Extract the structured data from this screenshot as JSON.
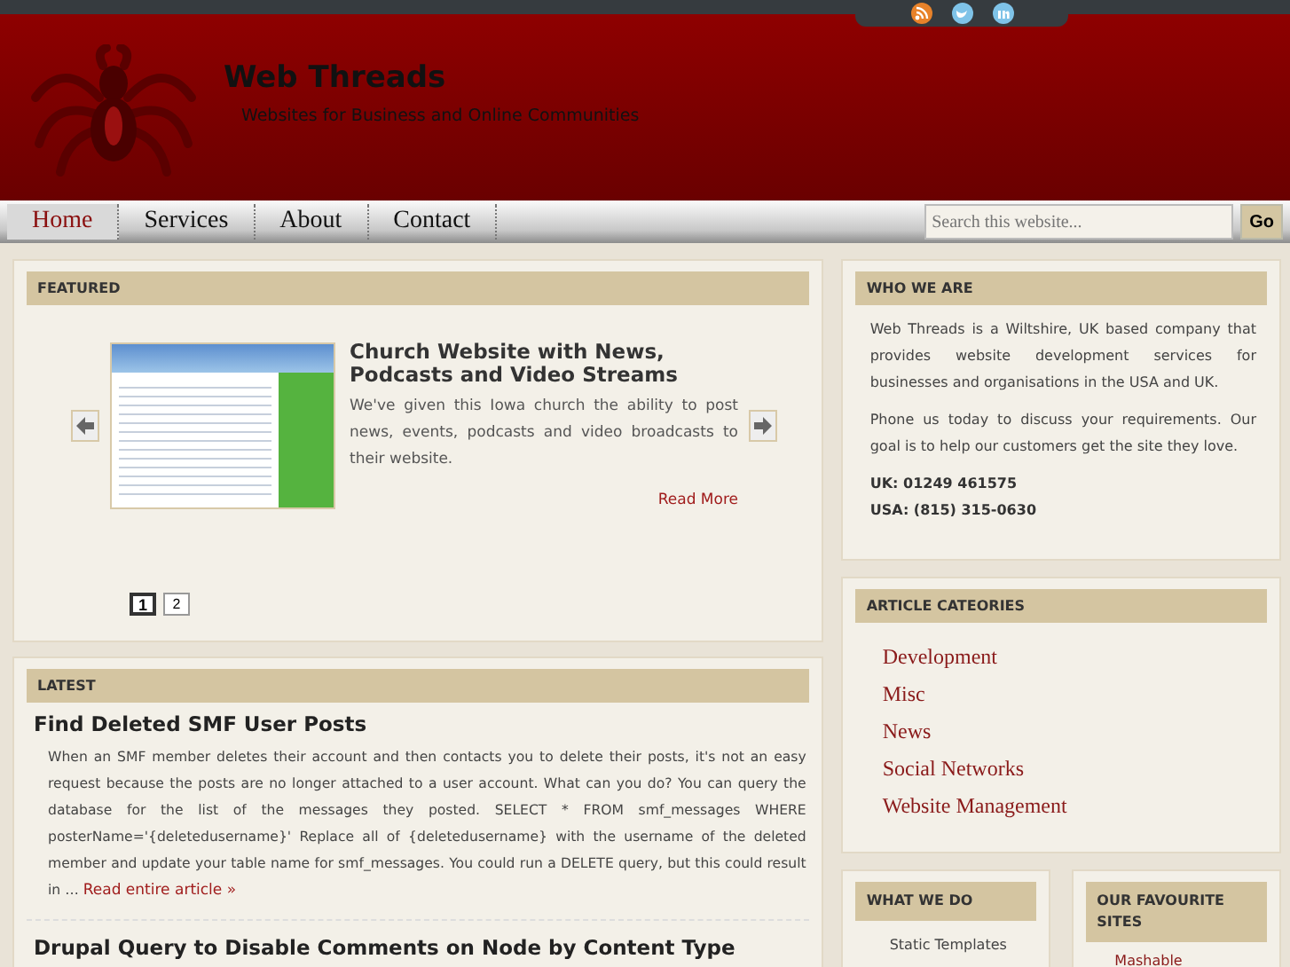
{
  "header": {
    "title": "Web Threads",
    "tagline": "Websites for Business and Online Communities"
  },
  "nav": [
    {
      "label": "Home",
      "selected": true
    },
    {
      "label": "Services",
      "selected": false
    },
    {
      "label": "About",
      "selected": false
    },
    {
      "label": "Contact",
      "selected": false
    }
  ],
  "search": {
    "placeholder": "Search this website...",
    "button": "Go"
  },
  "featured": {
    "heading": "FEATURED",
    "title": "Church Website with News, Podcasts and Video Streams",
    "text": "We've given this Iowa church the ability to post news, events, podcasts and video broadcasts to their website.",
    "link": "Read More",
    "pages": [
      {
        "label": "1",
        "selected": true
      },
      {
        "label": "2",
        "selected": false
      }
    ]
  },
  "latest": {
    "heading": "LATEST",
    "articles": [
      {
        "title": "Find Deleted SMF User Posts",
        "text": "When an SMF member deletes their account and then contacts you to delete their posts, it's not an easy request because the posts are no longer attached to a user account. What can you do? You can query the database for the list of the messages they posted. SELECT * FROM smf_messages WHERE posterName='{deletedusername}' Replace all of {deletedusername} with the username of the deleted member and update your table name for smf_messages. You could run a DELETE query, but this could result in …",
        "link": "Read entire article »"
      },
      {
        "title": "Drupal Query to Disable Comments on Node by Content Type"
      }
    ]
  },
  "who": {
    "heading": "WHO WE ARE",
    "paragraphs": [
      "Web Threads is a Wiltshire, UK based company that provides website development services for businesses and organisations in the USA and UK.",
      "Phone us today to discuss your requirements. Our goal is to help our customers get the site they love."
    ],
    "phones": [
      "UK: 01249 461575",
      "USA: (815) 315-0630"
    ]
  },
  "categories": {
    "heading": "ARTICLE CATEORIES",
    "items": [
      "Development",
      "Misc",
      "News",
      "Social Networks",
      "Website Management"
    ]
  },
  "what_we_do": {
    "heading": "WHAT WE DO",
    "items": [
      "Static Templates"
    ]
  },
  "favourites": {
    "heading": "OUR FAVOURITE SITES",
    "items": [
      "Mashable"
    ]
  }
}
